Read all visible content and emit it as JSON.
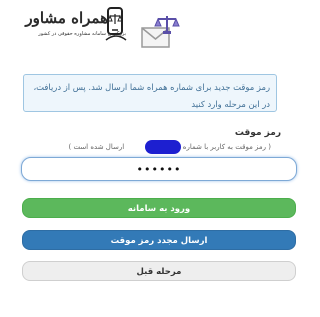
{
  "header": {
    "logo_title": "همراه مشاور",
    "logo_subtitle": "بزرگترین سامانه مشاوره حقوقی در کشور"
  },
  "info": {
    "message": "رمز موقت جدید برای شماره همراه شما ارسال شد. پس از دریافت، در این مرحله وارد کنید"
  },
  "field": {
    "label": "رمز موقت",
    "hint_left": "( رمز موقت به کاربر با شماره ملی",
    "hint_right": "ارسال شده است )",
    "value": "••••••"
  },
  "buttons": {
    "login": "ورود به سامانه",
    "resend": "ارسال مجدد رمز موقت",
    "back": "مرحله قبل"
  },
  "colors": {
    "login": "#5cb85c",
    "resend": "#337ab7",
    "back": "#eeeeee",
    "info_bg": "#eef6fc"
  }
}
